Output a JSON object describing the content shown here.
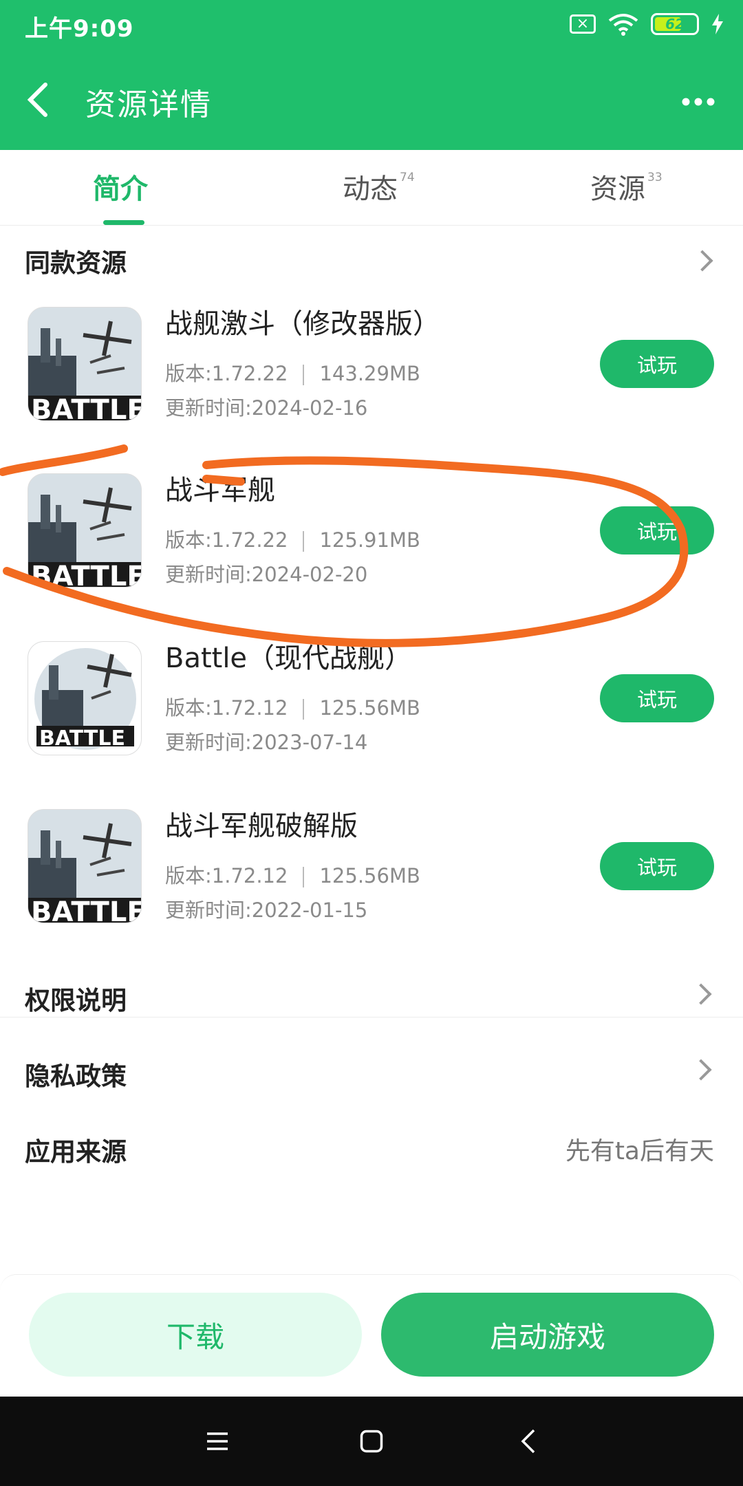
{
  "status_bar": {
    "time": "上午9:09",
    "battery": "62"
  },
  "header": {
    "title": "资源详情"
  },
  "tabs": [
    {
      "label": "简介",
      "count": ""
    },
    {
      "label": "动态",
      "count": "74"
    },
    {
      "label": "资源",
      "count": "33"
    }
  ],
  "same_resources": {
    "title": "同款资源",
    "items": [
      {
        "name": "战舰激斗（修改器版）",
        "version": "版本:1.72.22",
        "size": "143.29MB",
        "updated": "更新时间:2024-02-16",
        "button": "试玩"
      },
      {
        "name": "战斗军舰",
        "version": "版本:1.72.22",
        "size": "125.91MB",
        "updated": "更新时间:2024-02-20",
        "button": "试玩"
      },
      {
        "name": "Battle（现代战舰）",
        "version": "版本:1.72.12",
        "size": "125.56MB",
        "updated": "更新时间:2023-07-14",
        "button": "试玩"
      },
      {
        "name": "战斗军舰破解版",
        "version": "版本:1.72.12",
        "size": "125.56MB",
        "updated": "更新时间:2022-01-15",
        "button": "试玩"
      }
    ]
  },
  "info_rows": [
    {
      "label": "权限说明",
      "value": ""
    },
    {
      "label": "隐私政策",
      "value": ""
    },
    {
      "label": "应用来源",
      "value": "先有ta后有天"
    }
  ],
  "actions": {
    "download": "下载",
    "launch": "启动游戏"
  },
  "icon_text": "BATTLE",
  "colors": {
    "brand": "#1fbf6c",
    "button": "#1fb86a",
    "annotation": "#f26b21"
  }
}
